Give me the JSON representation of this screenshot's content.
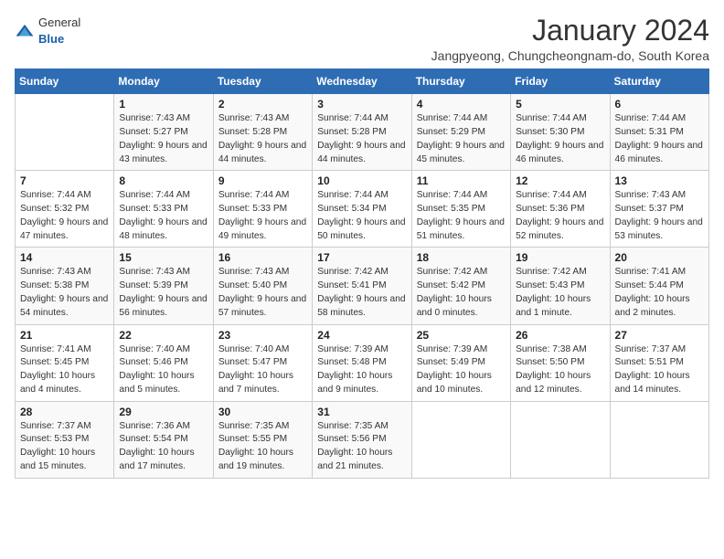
{
  "header": {
    "logo": {
      "general": "General",
      "blue": "Blue"
    },
    "title": "January 2024",
    "subtitle": "Jangpyeong, Chungcheongnam-do, South Korea"
  },
  "weekdays": [
    "Sunday",
    "Monday",
    "Tuesday",
    "Wednesday",
    "Thursday",
    "Friday",
    "Saturday"
  ],
  "weeks": [
    [
      {
        "day": "",
        "sunrise": "",
        "sunset": "",
        "daylight": ""
      },
      {
        "day": "1",
        "sunrise": "Sunrise: 7:43 AM",
        "sunset": "Sunset: 5:27 PM",
        "daylight": "Daylight: 9 hours and 43 minutes."
      },
      {
        "day": "2",
        "sunrise": "Sunrise: 7:43 AM",
        "sunset": "Sunset: 5:28 PM",
        "daylight": "Daylight: 9 hours and 44 minutes."
      },
      {
        "day": "3",
        "sunrise": "Sunrise: 7:44 AM",
        "sunset": "Sunset: 5:28 PM",
        "daylight": "Daylight: 9 hours and 44 minutes."
      },
      {
        "day": "4",
        "sunrise": "Sunrise: 7:44 AM",
        "sunset": "Sunset: 5:29 PM",
        "daylight": "Daylight: 9 hours and 45 minutes."
      },
      {
        "day": "5",
        "sunrise": "Sunrise: 7:44 AM",
        "sunset": "Sunset: 5:30 PM",
        "daylight": "Daylight: 9 hours and 46 minutes."
      },
      {
        "day": "6",
        "sunrise": "Sunrise: 7:44 AM",
        "sunset": "Sunset: 5:31 PM",
        "daylight": "Daylight: 9 hours and 46 minutes."
      }
    ],
    [
      {
        "day": "7",
        "sunrise": "Sunrise: 7:44 AM",
        "sunset": "Sunset: 5:32 PM",
        "daylight": "Daylight: 9 hours and 47 minutes."
      },
      {
        "day": "8",
        "sunrise": "Sunrise: 7:44 AM",
        "sunset": "Sunset: 5:33 PM",
        "daylight": "Daylight: 9 hours and 48 minutes."
      },
      {
        "day": "9",
        "sunrise": "Sunrise: 7:44 AM",
        "sunset": "Sunset: 5:33 PM",
        "daylight": "Daylight: 9 hours and 49 minutes."
      },
      {
        "day": "10",
        "sunrise": "Sunrise: 7:44 AM",
        "sunset": "Sunset: 5:34 PM",
        "daylight": "Daylight: 9 hours and 50 minutes."
      },
      {
        "day": "11",
        "sunrise": "Sunrise: 7:44 AM",
        "sunset": "Sunset: 5:35 PM",
        "daylight": "Daylight: 9 hours and 51 minutes."
      },
      {
        "day": "12",
        "sunrise": "Sunrise: 7:44 AM",
        "sunset": "Sunset: 5:36 PM",
        "daylight": "Daylight: 9 hours and 52 minutes."
      },
      {
        "day": "13",
        "sunrise": "Sunrise: 7:43 AM",
        "sunset": "Sunset: 5:37 PM",
        "daylight": "Daylight: 9 hours and 53 minutes."
      }
    ],
    [
      {
        "day": "14",
        "sunrise": "Sunrise: 7:43 AM",
        "sunset": "Sunset: 5:38 PM",
        "daylight": "Daylight: 9 hours and 54 minutes."
      },
      {
        "day": "15",
        "sunrise": "Sunrise: 7:43 AM",
        "sunset": "Sunset: 5:39 PM",
        "daylight": "Daylight: 9 hours and 56 minutes."
      },
      {
        "day": "16",
        "sunrise": "Sunrise: 7:43 AM",
        "sunset": "Sunset: 5:40 PM",
        "daylight": "Daylight: 9 hours and 57 minutes."
      },
      {
        "day": "17",
        "sunrise": "Sunrise: 7:42 AM",
        "sunset": "Sunset: 5:41 PM",
        "daylight": "Daylight: 9 hours and 58 minutes."
      },
      {
        "day": "18",
        "sunrise": "Sunrise: 7:42 AM",
        "sunset": "Sunset: 5:42 PM",
        "daylight": "Daylight: 10 hours and 0 minutes."
      },
      {
        "day": "19",
        "sunrise": "Sunrise: 7:42 AM",
        "sunset": "Sunset: 5:43 PM",
        "daylight": "Daylight: 10 hours and 1 minute."
      },
      {
        "day": "20",
        "sunrise": "Sunrise: 7:41 AM",
        "sunset": "Sunset: 5:44 PM",
        "daylight": "Daylight: 10 hours and 2 minutes."
      }
    ],
    [
      {
        "day": "21",
        "sunrise": "Sunrise: 7:41 AM",
        "sunset": "Sunset: 5:45 PM",
        "daylight": "Daylight: 10 hours and 4 minutes."
      },
      {
        "day": "22",
        "sunrise": "Sunrise: 7:40 AM",
        "sunset": "Sunset: 5:46 PM",
        "daylight": "Daylight: 10 hours and 5 minutes."
      },
      {
        "day": "23",
        "sunrise": "Sunrise: 7:40 AM",
        "sunset": "Sunset: 5:47 PM",
        "daylight": "Daylight: 10 hours and 7 minutes."
      },
      {
        "day": "24",
        "sunrise": "Sunrise: 7:39 AM",
        "sunset": "Sunset: 5:48 PM",
        "daylight": "Daylight: 10 hours and 9 minutes."
      },
      {
        "day": "25",
        "sunrise": "Sunrise: 7:39 AM",
        "sunset": "Sunset: 5:49 PM",
        "daylight": "Daylight: 10 hours and 10 minutes."
      },
      {
        "day": "26",
        "sunrise": "Sunrise: 7:38 AM",
        "sunset": "Sunset: 5:50 PM",
        "daylight": "Daylight: 10 hours and 12 minutes."
      },
      {
        "day": "27",
        "sunrise": "Sunrise: 7:37 AM",
        "sunset": "Sunset: 5:51 PM",
        "daylight": "Daylight: 10 hours and 14 minutes."
      }
    ],
    [
      {
        "day": "28",
        "sunrise": "Sunrise: 7:37 AM",
        "sunset": "Sunset: 5:53 PM",
        "daylight": "Daylight: 10 hours and 15 minutes."
      },
      {
        "day": "29",
        "sunrise": "Sunrise: 7:36 AM",
        "sunset": "Sunset: 5:54 PM",
        "daylight": "Daylight: 10 hours and 17 minutes."
      },
      {
        "day": "30",
        "sunrise": "Sunrise: 7:35 AM",
        "sunset": "Sunset: 5:55 PM",
        "daylight": "Daylight: 10 hours and 19 minutes."
      },
      {
        "day": "31",
        "sunrise": "Sunrise: 7:35 AM",
        "sunset": "Sunset: 5:56 PM",
        "daylight": "Daylight: 10 hours and 21 minutes."
      },
      {
        "day": "",
        "sunrise": "",
        "sunset": "",
        "daylight": ""
      },
      {
        "day": "",
        "sunrise": "",
        "sunset": "",
        "daylight": ""
      },
      {
        "day": "",
        "sunrise": "",
        "sunset": "",
        "daylight": ""
      }
    ]
  ]
}
